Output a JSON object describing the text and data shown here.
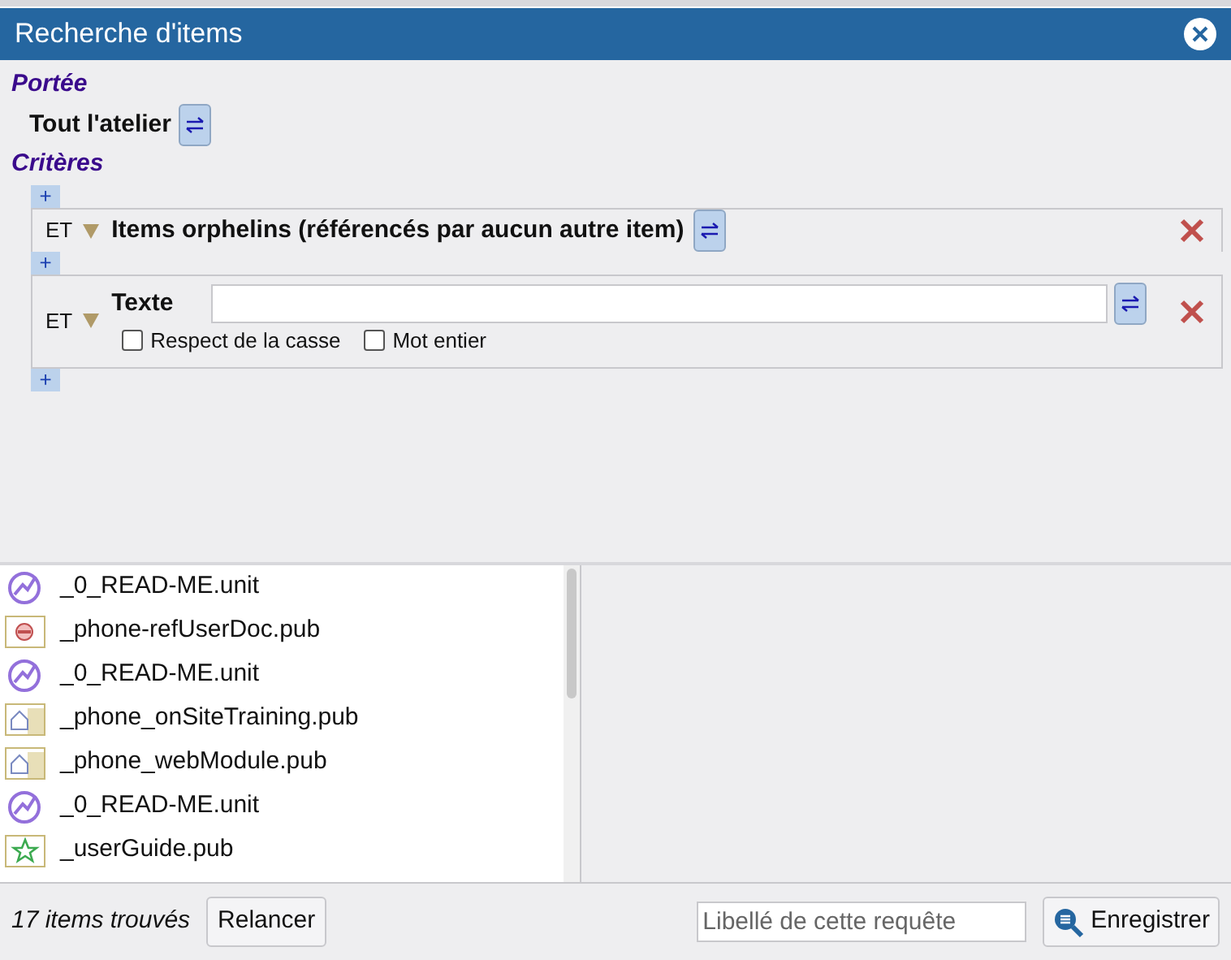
{
  "window": {
    "title": "Recherche d'items"
  },
  "scope": {
    "heading": "Portée",
    "value": "Tout l'atelier"
  },
  "criteria": {
    "heading": "Critères",
    "add_label": "+",
    "rows": [
      {
        "kind": "flag",
        "operator": "ET",
        "label": "Items orphelins (référencés par aucun autre item)"
      },
      {
        "kind": "text",
        "operator": "ET",
        "label": "Texte",
        "options": [
          {
            "label": "Respect de la casse",
            "checked": false
          },
          {
            "label": "Mot entier",
            "checked": false
          }
        ]
      }
    ]
  },
  "results": [
    {
      "kind": "unit",
      "name": "_0_READ-ME.unit"
    },
    {
      "kind": "doc",
      "name": "_phone-refUserDoc.pub"
    },
    {
      "kind": "unit",
      "name": "_0_READ-ME.unit"
    },
    {
      "kind": "home",
      "name": "_phone_onSiteTraining.pub"
    },
    {
      "kind": "home",
      "name": "_phone_webModule.pub"
    },
    {
      "kind": "unit",
      "name": "_0_READ-ME.unit"
    },
    {
      "kind": "star",
      "name": "_userGuide.pub"
    }
  ],
  "footer": {
    "count": "17 items trouvés",
    "rerun": "Relancer",
    "label_placeholder": "Libellé de cette requête",
    "save": "Enregistrer"
  }
}
